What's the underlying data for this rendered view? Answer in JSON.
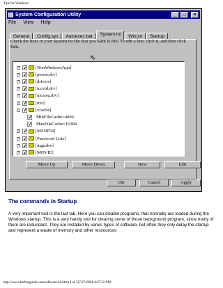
{
  "page": {
    "header": "Tips for Windows.",
    "footer": "http://www.karbosguide.com/software/18.htm (4 of 5)7/27/2004 4:07:22 AM"
  },
  "window": {
    "title": "System Configuration Utility",
    "controls": [
      "_",
      "□",
      "×"
    ],
    "menu": [
      "File",
      "View",
      "Help"
    ],
    "tabs": [
      "General",
      "Config.sys",
      "Autoexec.bat",
      "System.ini",
      "Win.ini",
      "Startup"
    ],
    "active_tab": "System.ini",
    "instructions": "Check the lines in your System.ini file that you want to run. To edit a line, click it, and then click Edit.",
    "tree": [
      {
        "label": "[NonWindowsApp]",
        "checked": true,
        "expanded": false
      },
      {
        "label": "[power.drv]",
        "checked": true,
        "expanded": false
      },
      {
        "label": "[drivers]",
        "checked": true,
        "expanded": false
      },
      {
        "label": "[iccvid.drv]",
        "checked": true,
        "expanded": false
      },
      {
        "label": "[mciseq.drv]",
        "checked": true,
        "expanded": false
      },
      {
        "label": "[mci]",
        "checked": true,
        "expanded": false
      },
      {
        "label": "[vcache]",
        "checked": true,
        "expanded": true
      },
      {
        "label": "MinFileCache=4096",
        "checked": true,
        "child": true
      },
      {
        "label": "MaxFileCache=16384",
        "checked": true,
        "child": true
      },
      {
        "label": "[MSNP32]",
        "checked": true,
        "expanded": false
      },
      {
        "label": "[Password Lists]",
        "checked": true,
        "expanded": false
      },
      {
        "label": "[mga.drv]",
        "checked": true,
        "expanded": false
      },
      {
        "label": "[MOVIE]",
        "checked": true,
        "expanded": false
      }
    ],
    "buttons": {
      "move_up": "Move Up",
      "move_down": "Move Down",
      "new": "New",
      "edit": "Edit",
      "ok": "OK",
      "cancel": "Cancel",
      "apply": "Apply"
    }
  },
  "article": {
    "heading": "The commands in Startup",
    "paragraph": "A very important tool is the last tab. Here you can disable programs, that normally are loaded during the Windows startup. This is a very handy tool for clearing some of those background program, since many of them are redundant. They are installed by varies types of software, but often they only delay the startup and represent a waste of memory and other ressources:"
  },
  "colors": {
    "titlebar": "#000080",
    "dialog": "#c0c0c0",
    "heading": "#000080"
  }
}
